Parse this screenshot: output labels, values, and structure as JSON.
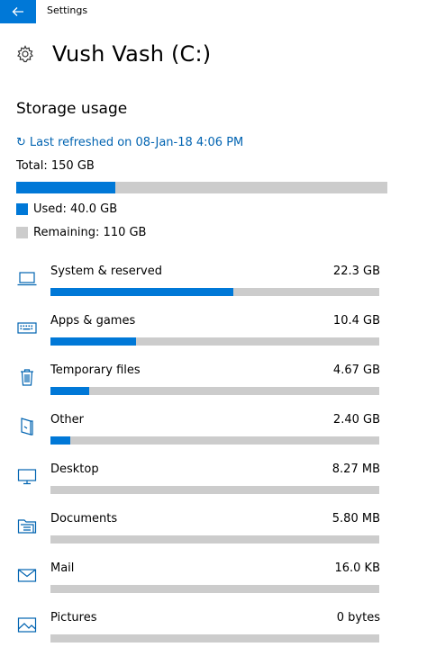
{
  "window": {
    "title": "Settings"
  },
  "page": {
    "title": "Vush Vash (C:)",
    "section_title": "Storage usage"
  },
  "refresh": {
    "text": "Last refreshed on 08-Jan-18 4:06 PM"
  },
  "storage": {
    "total_text": "Total: 150 GB",
    "used_fraction": 0.267,
    "used_text": "Used: 40.0 GB",
    "remaining_text": "Remaining: 110 GB"
  },
  "colors": {
    "accent": "#0078d7",
    "bar_bg": "#cccccc",
    "link": "#0063b1"
  },
  "categories": [
    {
      "label": "System & reserved",
      "size": "22.3 GB",
      "fraction": 0.557,
      "icon": "laptop-icon"
    },
    {
      "label": "Apps & games",
      "size": "10.4 GB",
      "fraction": 0.26,
      "icon": "keyboard-icon"
    },
    {
      "label": "Temporary files",
      "size": "4.67 GB",
      "fraction": 0.117,
      "icon": "trash-icon"
    },
    {
      "label": "Other",
      "size": "2.40 GB",
      "fraction": 0.06,
      "icon": "other-files-icon"
    },
    {
      "label": "Desktop",
      "size": "8.27 MB",
      "fraction": 0,
      "icon": "monitor-icon"
    },
    {
      "label": "Documents",
      "size": "5.80 MB",
      "fraction": 0,
      "icon": "documents-folder-icon"
    },
    {
      "label": "Mail",
      "size": "16.0 KB",
      "fraction": 0,
      "icon": "mail-icon"
    },
    {
      "label": "Pictures",
      "size": "0 bytes",
      "fraction": 0,
      "icon": "pictures-icon"
    }
  ]
}
